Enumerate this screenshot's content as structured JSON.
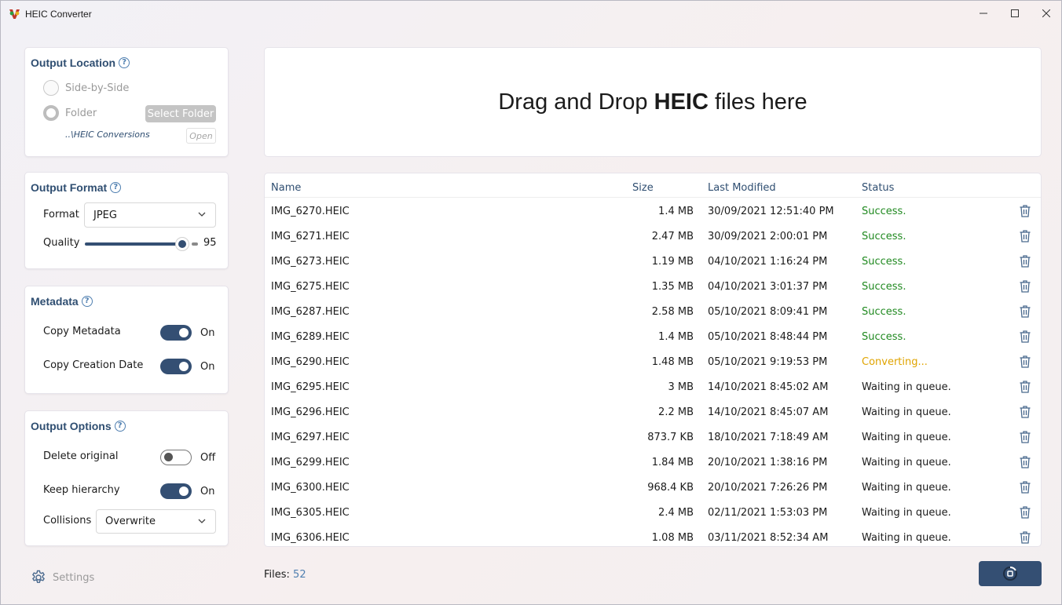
{
  "window": {
    "title": "HEIC Converter"
  },
  "output_location": {
    "title": "Output Location",
    "options": [
      {
        "label": "Side-by-Side",
        "selected": false
      },
      {
        "label": "Folder",
        "selected": true
      }
    ],
    "select_folder_label": "Select Folder",
    "folder_path": "..\\HEIC Conversions",
    "open_label": "Open"
  },
  "output_format": {
    "title": "Output Format",
    "format_label": "Format",
    "format_value": "JPEG",
    "quality_label": "Quality",
    "quality_value": "95"
  },
  "metadata": {
    "title": "Metadata",
    "items": [
      {
        "label": "Copy Metadata",
        "state": "On"
      },
      {
        "label": "Copy Creation Date",
        "state": "On"
      }
    ]
  },
  "output_options": {
    "title": "Output Options",
    "items": [
      {
        "label": "Delete original",
        "state": "Off"
      },
      {
        "label": "Keep hierarchy",
        "state": "On"
      }
    ],
    "collisions_label": "Collisions",
    "collisions_value": "Overwrite"
  },
  "settings_label": "Settings",
  "dropzone": {
    "pre": "Drag and Drop ",
    "bold": "HEIC",
    "post": " files here"
  },
  "table": {
    "columns": [
      "Name",
      "Size",
      "Last Modified",
      "Status"
    ],
    "rows": [
      {
        "name": "IMG_6270.HEIC",
        "size": "1.4 MB",
        "modified": "30/09/2021 12:51:40 PM",
        "status": "Success."
      },
      {
        "name": "IMG_6271.HEIC",
        "size": "2.47 MB",
        "modified": "30/09/2021 2:00:01 PM",
        "status": "Success."
      },
      {
        "name": "IMG_6273.HEIC",
        "size": "1.19 MB",
        "modified": "04/10/2021 1:16:24 PM",
        "status": "Success."
      },
      {
        "name": "IMG_6275.HEIC",
        "size": "1.35 MB",
        "modified": "04/10/2021 3:01:37 PM",
        "status": "Success."
      },
      {
        "name": "IMG_6287.HEIC",
        "size": "2.58 MB",
        "modified": "05/10/2021 8:09:41 PM",
        "status": "Success."
      },
      {
        "name": "IMG_6289.HEIC",
        "size": "1.4 MB",
        "modified": "05/10/2021 8:48:44 PM",
        "status": "Success."
      },
      {
        "name": "IMG_6290.HEIC",
        "size": "1.48 MB",
        "modified": "05/10/2021 9:19:53 PM",
        "status": "Converting..."
      },
      {
        "name": "IMG_6295.HEIC",
        "size": "3 MB",
        "modified": "14/10/2021 8:45:02 AM",
        "status": "Waiting in queue."
      },
      {
        "name": "IMG_6296.HEIC",
        "size": "2.2 MB",
        "modified": "14/10/2021 8:45:07 AM",
        "status": "Waiting in queue."
      },
      {
        "name": "IMG_6297.HEIC",
        "size": "873.7 KB",
        "modified": "18/10/2021 7:18:49 AM",
        "status": "Waiting in queue."
      },
      {
        "name": "IMG_6299.HEIC",
        "size": "1.84 MB",
        "modified": "20/10/2021 1:38:16 PM",
        "status": "Waiting in queue."
      },
      {
        "name": "IMG_6300.HEIC",
        "size": "968.4 KB",
        "modified": "20/10/2021 7:26:26 PM",
        "status": "Waiting in queue."
      },
      {
        "name": "IMG_6305.HEIC",
        "size": "2.4 MB",
        "modified": "02/11/2021 1:53:03 PM",
        "status": "Waiting in queue."
      },
      {
        "name": "IMG_6306.HEIC",
        "size": "1.08 MB",
        "modified": "03/11/2021 8:52:34 AM",
        "status": "Waiting in queue."
      }
    ]
  },
  "files": {
    "label": "Files:",
    "count": "52"
  },
  "colors": {
    "accent": "#344f73",
    "success": "#218a21",
    "converting": "#e0a400",
    "link": "#4f7fb0"
  },
  "icons": {
    "app": "heic-converter-logo-icon",
    "help": "help-circle-icon",
    "settings": "gear-icon",
    "delete": "trash-icon",
    "convert": "stop-progress-icon",
    "dropdown": "chevron-down-icon"
  }
}
